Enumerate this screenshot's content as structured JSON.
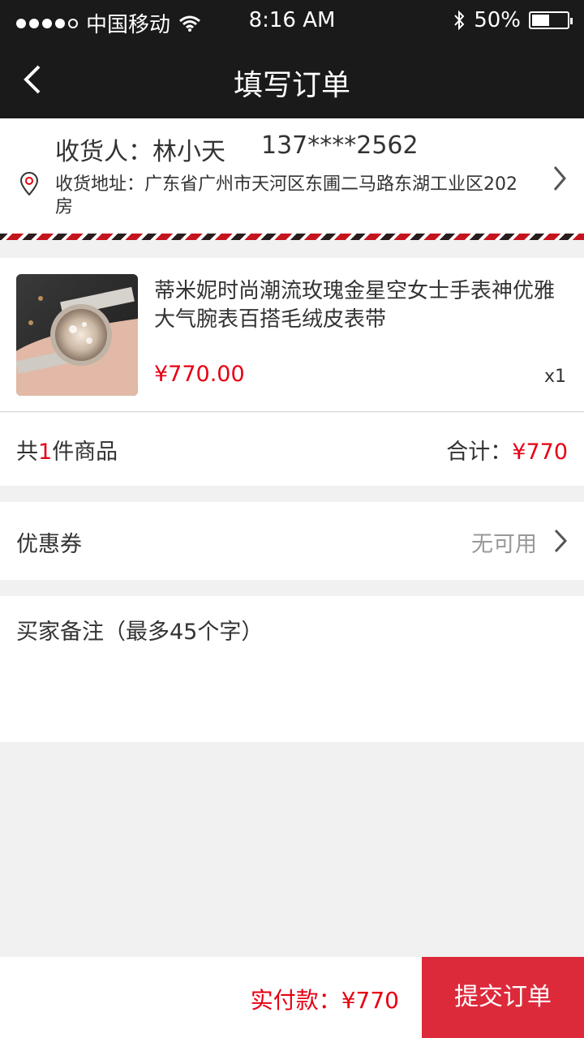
{
  "status_bar": {
    "carrier": "中国移动",
    "time": "8:16 AM",
    "battery": "50%",
    "battery_level": 0.5,
    "signal_bars": 4
  },
  "header": {
    "title": "填写订单",
    "back_icon": "chevron-left-icon"
  },
  "address": {
    "recipient": "收货人：林小天",
    "phone": "137****2562",
    "address_text": "收货地址：广东省广州市天河区东圃二马路东湖工业区202房",
    "icons": [
      "location-pin-icon",
      "chevron-right-icon"
    ]
  },
  "product": {
    "name": "蒂米妮时尚潮流玫瑰金星空女士手表神优雅大气腕表百搭毛绒皮表带",
    "price": "¥770.00",
    "quantity": "x1"
  },
  "summary": {
    "count_prefix": "共",
    "count_num": "1",
    "count_suffix": "件商品",
    "total_label": "合计：",
    "total_amount": "¥770"
  },
  "coupon": {
    "label": "优惠券",
    "value": "无可用"
  },
  "remark": {
    "placeholder": "买家备注（最多45个字）"
  },
  "footer": {
    "pay_label": "实付款：",
    "pay_amount": "¥770",
    "submit_label": "提交订单"
  },
  "colors": {
    "accent_red": "#e60012",
    "submit_bg": "#dd2a3b",
    "header_bg": "#1a1a1a",
    "page_bg": "#f1f1f1"
  }
}
